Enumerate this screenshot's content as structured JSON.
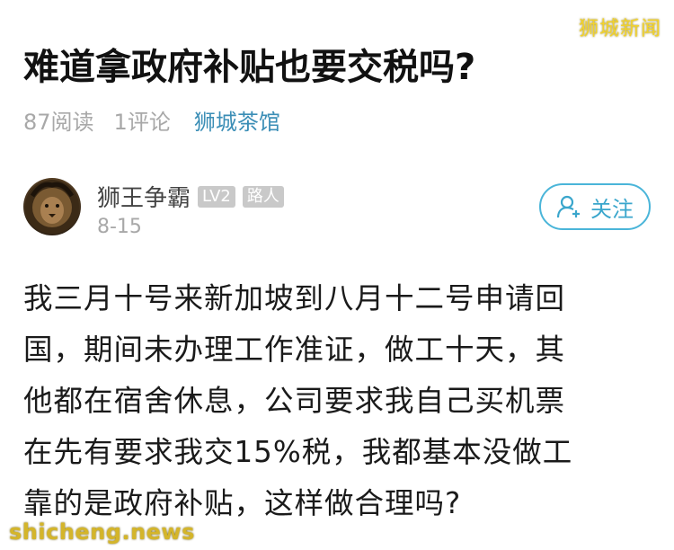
{
  "watermark": {
    "top_right": "狮城新闻",
    "bottom_left": "shicheng.news"
  },
  "post": {
    "title": "难道拿政府补贴也要交税吗?",
    "reads": "87阅读",
    "comments": "1评论",
    "group": "狮城茶馆"
  },
  "author": {
    "name": "狮王争霸",
    "level_badge": "LV2",
    "role_badge": "路人",
    "date": "8-15",
    "avatar_icon": "lion-avatar"
  },
  "follow_button": {
    "label": "关注",
    "icon": "add-user-icon",
    "color": "#3aa6cc"
  },
  "body": {
    "lines": [
      "我三月十号来新加坡到八月十二号申请回",
      "国，期间未办理工作准证，做工十天，其",
      "他都在宿舍休息，公司要求我自己买机票",
      "在先有要求我交15%税，我都基本没做工",
      "靠的是政府补贴，这样做合理吗?"
    ]
  }
}
